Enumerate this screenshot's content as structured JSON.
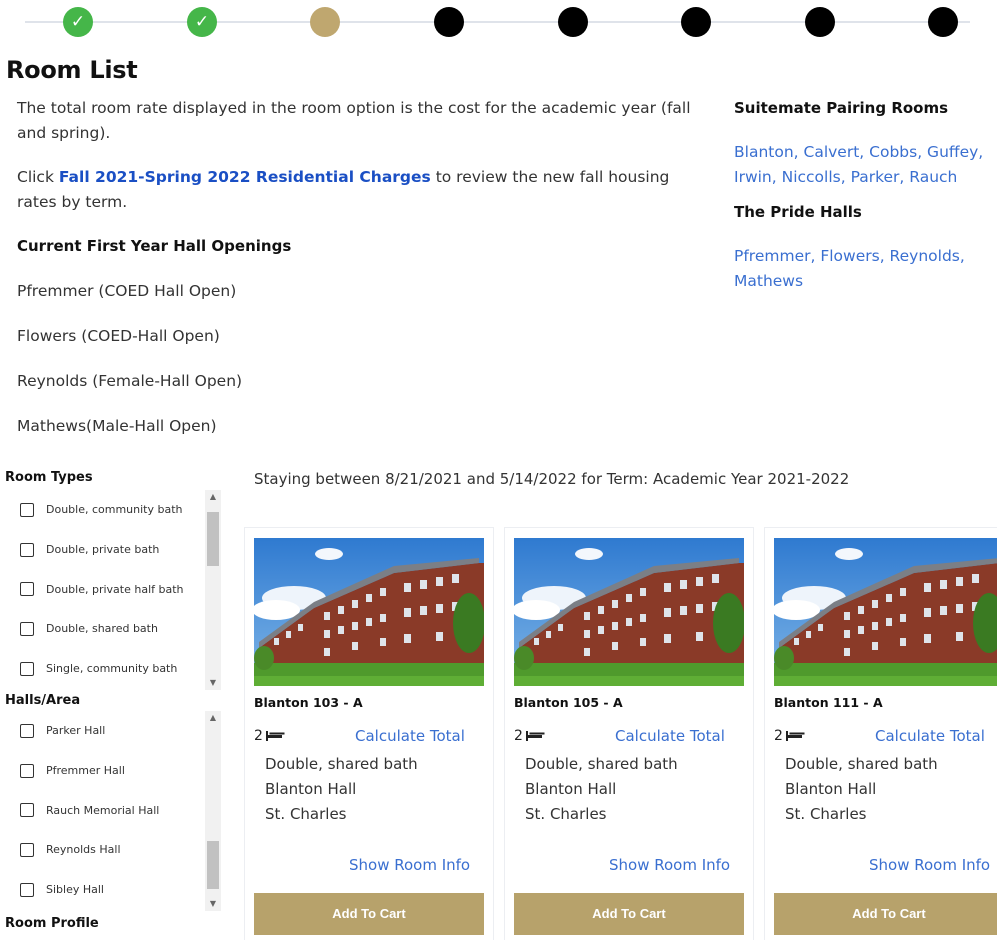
{
  "stepper": {
    "steps": [
      {
        "state": "done",
        "icon": "checkmark-icon"
      },
      {
        "state": "done",
        "icon": "checkmark-icon"
      },
      {
        "state": "current"
      },
      {
        "state": "pending"
      },
      {
        "state": "pending"
      },
      {
        "state": "pending"
      },
      {
        "state": "pending"
      },
      {
        "state": "pending"
      }
    ],
    "check_glyph": "✓"
  },
  "page_title": "Room List",
  "intro": {
    "rate_text": "The total room rate displayed in the room option is the cost for the academic year (fall and spring).",
    "click_prefix": "Click ",
    "charges_link": "Fall 2021-Spring 2022 Residential Charges",
    "click_suffix": " to review the new fall housing rates by term.",
    "openings_heading": "Current First Year Hall Openings",
    "halls": [
      "Pfremmer (COED Hall Open)",
      "Flowers (COED-Hall Open)",
      "Reynolds (Female-Hall Open)",
      "Mathews(Male-Hall Open)"
    ]
  },
  "side": {
    "suitemate_heading": "Suitemate Pairing Rooms",
    "suitemate_links": "Blanton, Calvert, Cobbs, Guffey, Irwin, Niccolls, Parker, Rauch",
    "pride_heading": "The Pride Halls",
    "pride_links": "Pfremmer, Flowers, Reynolds, Mathews"
  },
  "filters": {
    "room_types_heading": "Room Types",
    "room_types": [
      "Double, community bath",
      "Double, private bath",
      "Double, private half bath",
      "Double, shared bath",
      "Single, community bath"
    ],
    "halls_heading": "Halls/Area",
    "halls": [
      "Parker Hall",
      "Pfremmer Hall",
      "Rauch Memorial Hall",
      "Reynolds Hall",
      "Sibley Hall"
    ],
    "profile_heading": "Room Profile"
  },
  "staying_text": "Staying between 8/21/2021 and 5/14/2022 for Term: Academic Year 2021-2022",
  "rooms": [
    {
      "name": "Blanton 103 - A",
      "beds": "2",
      "calc_label": "Calculate Total",
      "type": "Double, shared bath",
      "hall": "Blanton Hall",
      "location": "St. Charles",
      "info_label": "Show Room Info",
      "cart_label": "Add To Cart"
    },
    {
      "name": "Blanton 105 - A",
      "beds": "2",
      "calc_label": "Calculate Total",
      "type": "Double, shared bath",
      "hall": "Blanton Hall",
      "location": "St. Charles",
      "info_label": "Show Room Info",
      "cart_label": "Add To Cart"
    },
    {
      "name": "Blanton 111 - A",
      "beds": "2",
      "calc_label": "Calculate Total",
      "type": "Double, shared bath",
      "hall": "Blanton Hall",
      "location": "St. Charles",
      "info_label": "Show Room Info",
      "cart_label": "Add To Cart"
    }
  ],
  "colors": {
    "done": "#45b649",
    "current": "#bfa76f",
    "pending": "#000000",
    "link": "#3a6fd0",
    "cart_button": "#b7a26b"
  }
}
